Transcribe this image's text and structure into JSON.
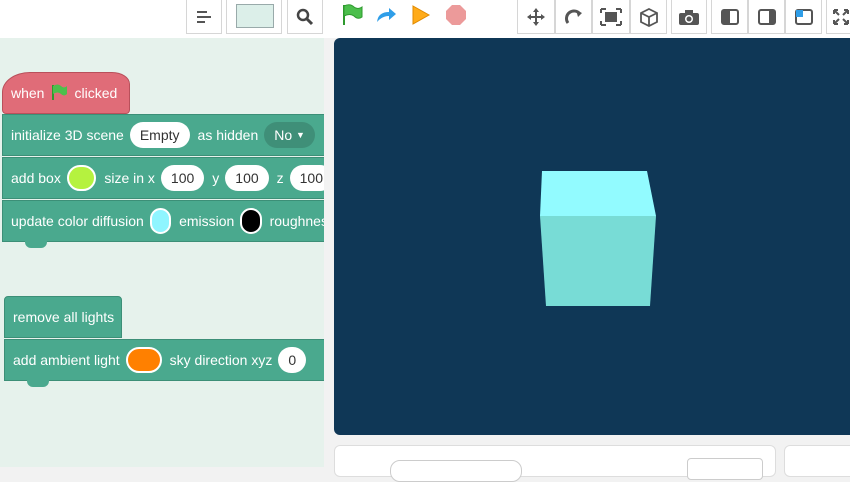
{
  "toolbar": {
    "icons": [
      "list-icon",
      "color-swatch",
      "search-icon",
      "green-flag-icon",
      "redo-icon",
      "play-icon",
      "stop-icon",
      "move-icon",
      "rotate-icon",
      "fullscreen-icon",
      "cube-icon",
      "camera-icon",
      "layout-left-icon",
      "layout-right-icon",
      "layout-corner-icon",
      "expand-icon"
    ],
    "swatch_color": "#dcefe9"
  },
  "blocks": {
    "hat": {
      "when": "when",
      "clicked": "clicked",
      "color": "#e06c78"
    },
    "init": {
      "label": "initialize 3D scene",
      "value": "Empty",
      "as": "as hidden",
      "dropdown": "No"
    },
    "addbox": {
      "label": "add box",
      "color": "#b5f23f",
      "size": "size in x",
      "x": "100",
      "y_label": "y",
      "y": "100",
      "z_label": "z",
      "z": "100"
    },
    "update": {
      "label": "update color diffusion",
      "diff_color": "#8ff5ff",
      "emission": "emission",
      "emission_color": "#000000",
      "rough": "roughness"
    },
    "removelights": {
      "label": "remove all lights"
    },
    "ambient": {
      "label": "add ambient light",
      "color": "#ff8000",
      "sky": "sky direction xyz",
      "value": "0"
    }
  },
  "stage": {
    "background": "#0f3756",
    "cube_front": "#78dcd6",
    "cube_top": "#92fbff"
  }
}
